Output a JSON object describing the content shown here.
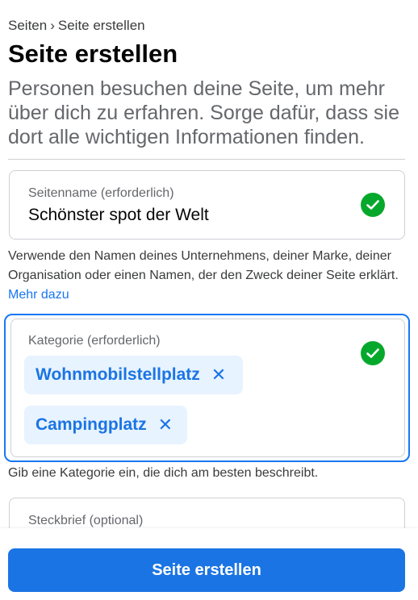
{
  "breadcrumb": {
    "parent": "Seiten",
    "separator": "›",
    "current": "Seite erstellen"
  },
  "title": "Seite erstellen",
  "intro": "Personen besuchen deine Seite, um mehr über dich zu erfahren. Sorge dafür, dass sie dort alle wichtigen Informationen finden.",
  "page_name": {
    "label": "Seitenname (erforderlich)",
    "value": "Schönster spot der Welt",
    "valid_icon": "check-circle-icon",
    "help_text": "Verwende den Namen deines Unternehmens, deiner Marke, deiner Organisation oder einen Namen, der den Zweck deiner Seite erklärt.",
    "help_link": "Mehr dazu"
  },
  "category": {
    "label": "Kategorie (erforderlich)",
    "valid_icon": "check-circle-icon",
    "chips": [
      {
        "label": "Wohnmobilstellplatz",
        "remove_icon": "close-icon"
      },
      {
        "label": "Campingplatz",
        "remove_icon": "close-icon"
      }
    ],
    "help_text": "Gib eine Kategorie ein, die dich am besten beschreibt."
  },
  "bio": {
    "label": "Steckbrief (optional)"
  },
  "submit_label": "Seite erstellen",
  "colors": {
    "accent": "#1b74e4",
    "success": "#06a82c",
    "chip_background": "#e7f3ff"
  }
}
